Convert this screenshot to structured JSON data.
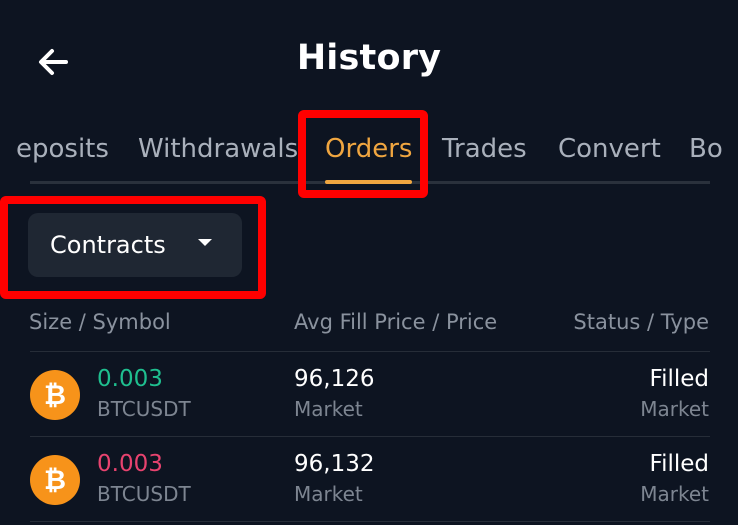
{
  "header": {
    "title": "History",
    "back_icon": "arrow-left-icon"
  },
  "tabs": [
    {
      "label": "eposits",
      "active": false
    },
    {
      "label": "Withdrawals",
      "active": false
    },
    {
      "label": "Orders",
      "active": true
    },
    {
      "label": "Trades",
      "active": false
    },
    {
      "label": "Convert",
      "active": false
    },
    {
      "label": "Bo",
      "active": false
    }
  ],
  "filter": {
    "selected": "Contracts",
    "caret_icon": "caret-down-icon"
  },
  "columns": {
    "col1": "Size / Symbol",
    "col2": "Avg Fill Price / Price",
    "col3": "Status / Type"
  },
  "orders": [
    {
      "coin_icon": "bitcoin-icon",
      "size": "0.003",
      "size_color": "#1fbf8f",
      "symbol": "BTCUSDT",
      "price": "96,126",
      "price_type": "Market",
      "status": "Filled",
      "order_type": "Market"
    },
    {
      "coin_icon": "bitcoin-icon",
      "size": "0.003",
      "size_color": "#e8436f",
      "symbol": "BTCUSDT",
      "price": "96,132",
      "price_type": "Market",
      "status": "Filled",
      "order_type": "Market"
    }
  ],
  "colors": {
    "background": "#0d1421",
    "accent": "#f0a640",
    "highlight": "#ff0000",
    "buy": "#1fbf8f",
    "sell": "#e8436f"
  }
}
